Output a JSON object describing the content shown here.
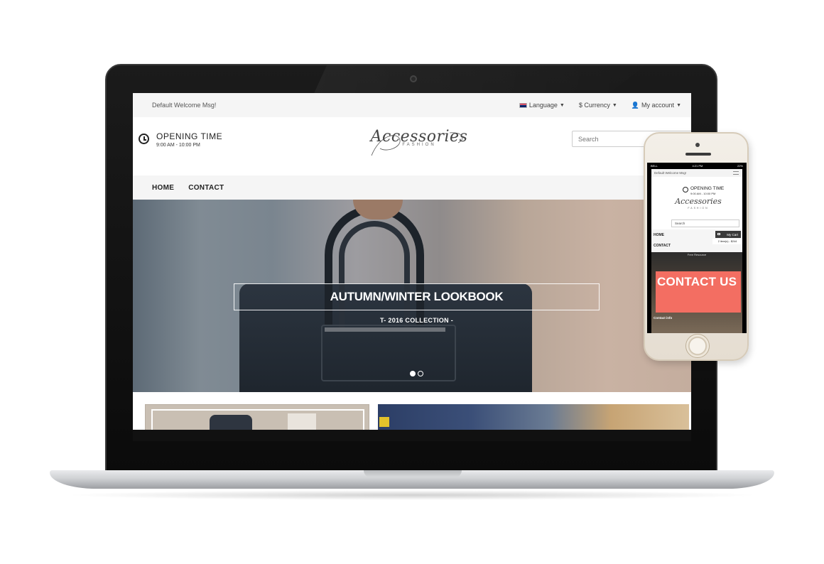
{
  "desktop": {
    "topbar": {
      "welcome": "Default Welcome Msg!",
      "language": "Language",
      "currency": "$ Currency",
      "account": "My account"
    },
    "header": {
      "opening_title": "OPENING TIME",
      "opening_hours": "9:00 AM - 10:00 PM",
      "logo_script": "Accessories",
      "logo_sub": "FASHION",
      "search_placeholder": "Search"
    },
    "nav": [
      "HOME",
      "CONTACT"
    ],
    "hero": {
      "title": "AUTUMN/WINTER LOOKBOOK",
      "subtitle": "T- 2016 COLLECTION -",
      "slides": 2,
      "active_slide": 1
    }
  },
  "mobile": {
    "status": {
      "carrier": "BELL",
      "time": "4:21 PM",
      "battery": "22%"
    },
    "welcome": "Default Welcome Msg!",
    "opening_title": "OPENING TIME",
    "opening_hours": "9:00 AM - 10:00 PM",
    "logo_script": "Accessories",
    "logo_sub": "FASHION",
    "search_placeholder": "Search",
    "nav": [
      "HOME",
      "CONTACT"
    ],
    "cart_label": "My Cart",
    "cart_total": "2 item(s) - $244",
    "banner_top": "Free Resource",
    "contact_heading": "CONTACT US",
    "contact_info": "Contact info"
  },
  "colors": {
    "contact_box": "#f36e62",
    "topbar_bg": "#f5f5f5"
  }
}
